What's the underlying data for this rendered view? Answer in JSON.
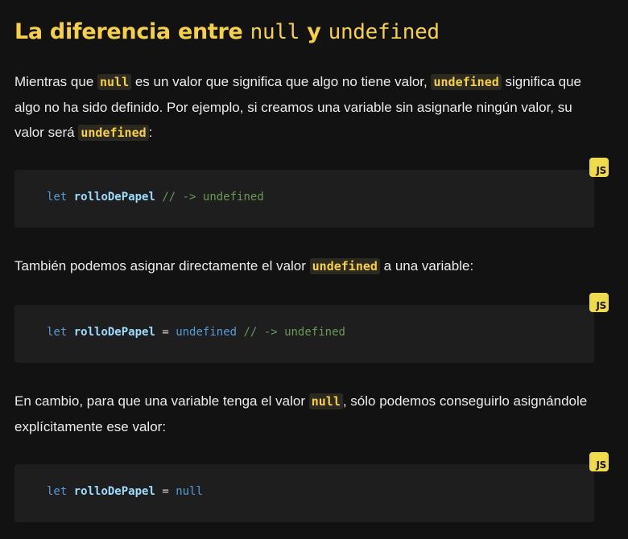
{
  "heading": {
    "part1": "La diferencia entre ",
    "code1": "null",
    "part2": " y ",
    "code2": "undefined"
  },
  "para1": {
    "t1": "Mientras que ",
    "c1": "null",
    "t2": " es un valor que significa que algo no tiene valor, ",
    "c2": "undefined",
    "t3": " significa que algo no ha sido definido. Por ejemplo, si creamos una variable sin asignarle ningún valor, su valor será ",
    "c3": "undefined",
    "t4": ":"
  },
  "code1": {
    "badge": "JS",
    "kw": "let",
    "var": "rolloDePapel",
    "comment": "// -> undefined"
  },
  "para2": {
    "t1": "También podemos asignar directamente el valor ",
    "c1": "undefined",
    "t2": " a una variable:"
  },
  "code2": {
    "badge": "JS",
    "kw": "let",
    "var": "rolloDePapel",
    "op": "=",
    "val": "undefined",
    "comment": "// -> undefined"
  },
  "para3": {
    "t1": "En cambio, para que una variable tenga el valor ",
    "c1": "null",
    "t2": ", sólo podemos conseguirlo asignándole explícitamente ese valor:"
  },
  "code3": {
    "badge": "JS",
    "kw": "let",
    "var": "rolloDePapel",
    "op": "=",
    "val": "null"
  },
  "colors": {
    "background": "#121212",
    "accent": "#f7d044",
    "code_bg": "#1e1e1e",
    "js_badge": "#f0db4f"
  }
}
